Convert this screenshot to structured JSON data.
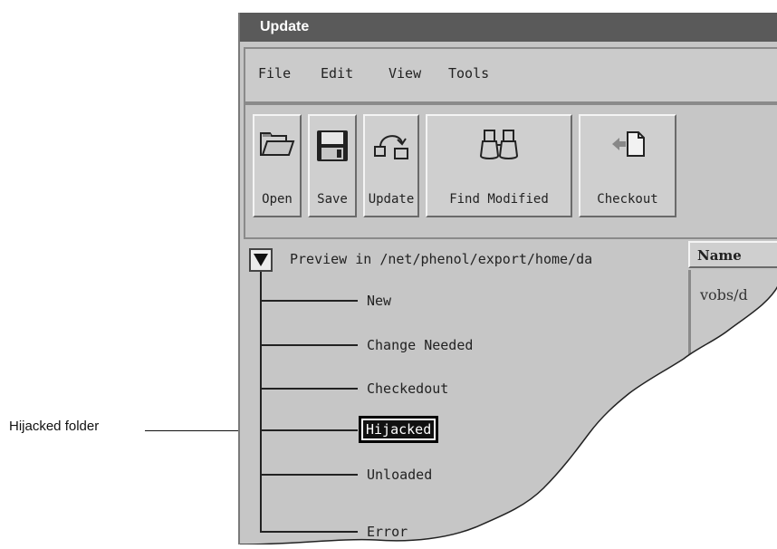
{
  "window": {
    "title": "Update"
  },
  "menu": {
    "items": [
      "File",
      "Edit",
      "View",
      "Tools"
    ]
  },
  "toolbar": {
    "buttons": [
      {
        "label": "Open",
        "icon": "folder-icon"
      },
      {
        "label": "Save",
        "icon": "floppy-disk-icon"
      },
      {
        "label": "Update",
        "icon": "update-icon"
      },
      {
        "label": "Find Modified",
        "icon": "binoculars-icon"
      },
      {
        "label": "Checkout",
        "icon": "checkout-icon"
      }
    ]
  },
  "tree": {
    "root_label": "Preview in /net/phenol/export/home/da",
    "nodes": [
      "New",
      "Change Needed",
      "Checkedout",
      "Hijacked",
      "Unloaded",
      "Error"
    ],
    "selected": "Hijacked"
  },
  "list": {
    "column_header": "Name",
    "rows": [
      "vobs/d"
    ]
  },
  "annotation": {
    "label": "Hijacked folder"
  }
}
